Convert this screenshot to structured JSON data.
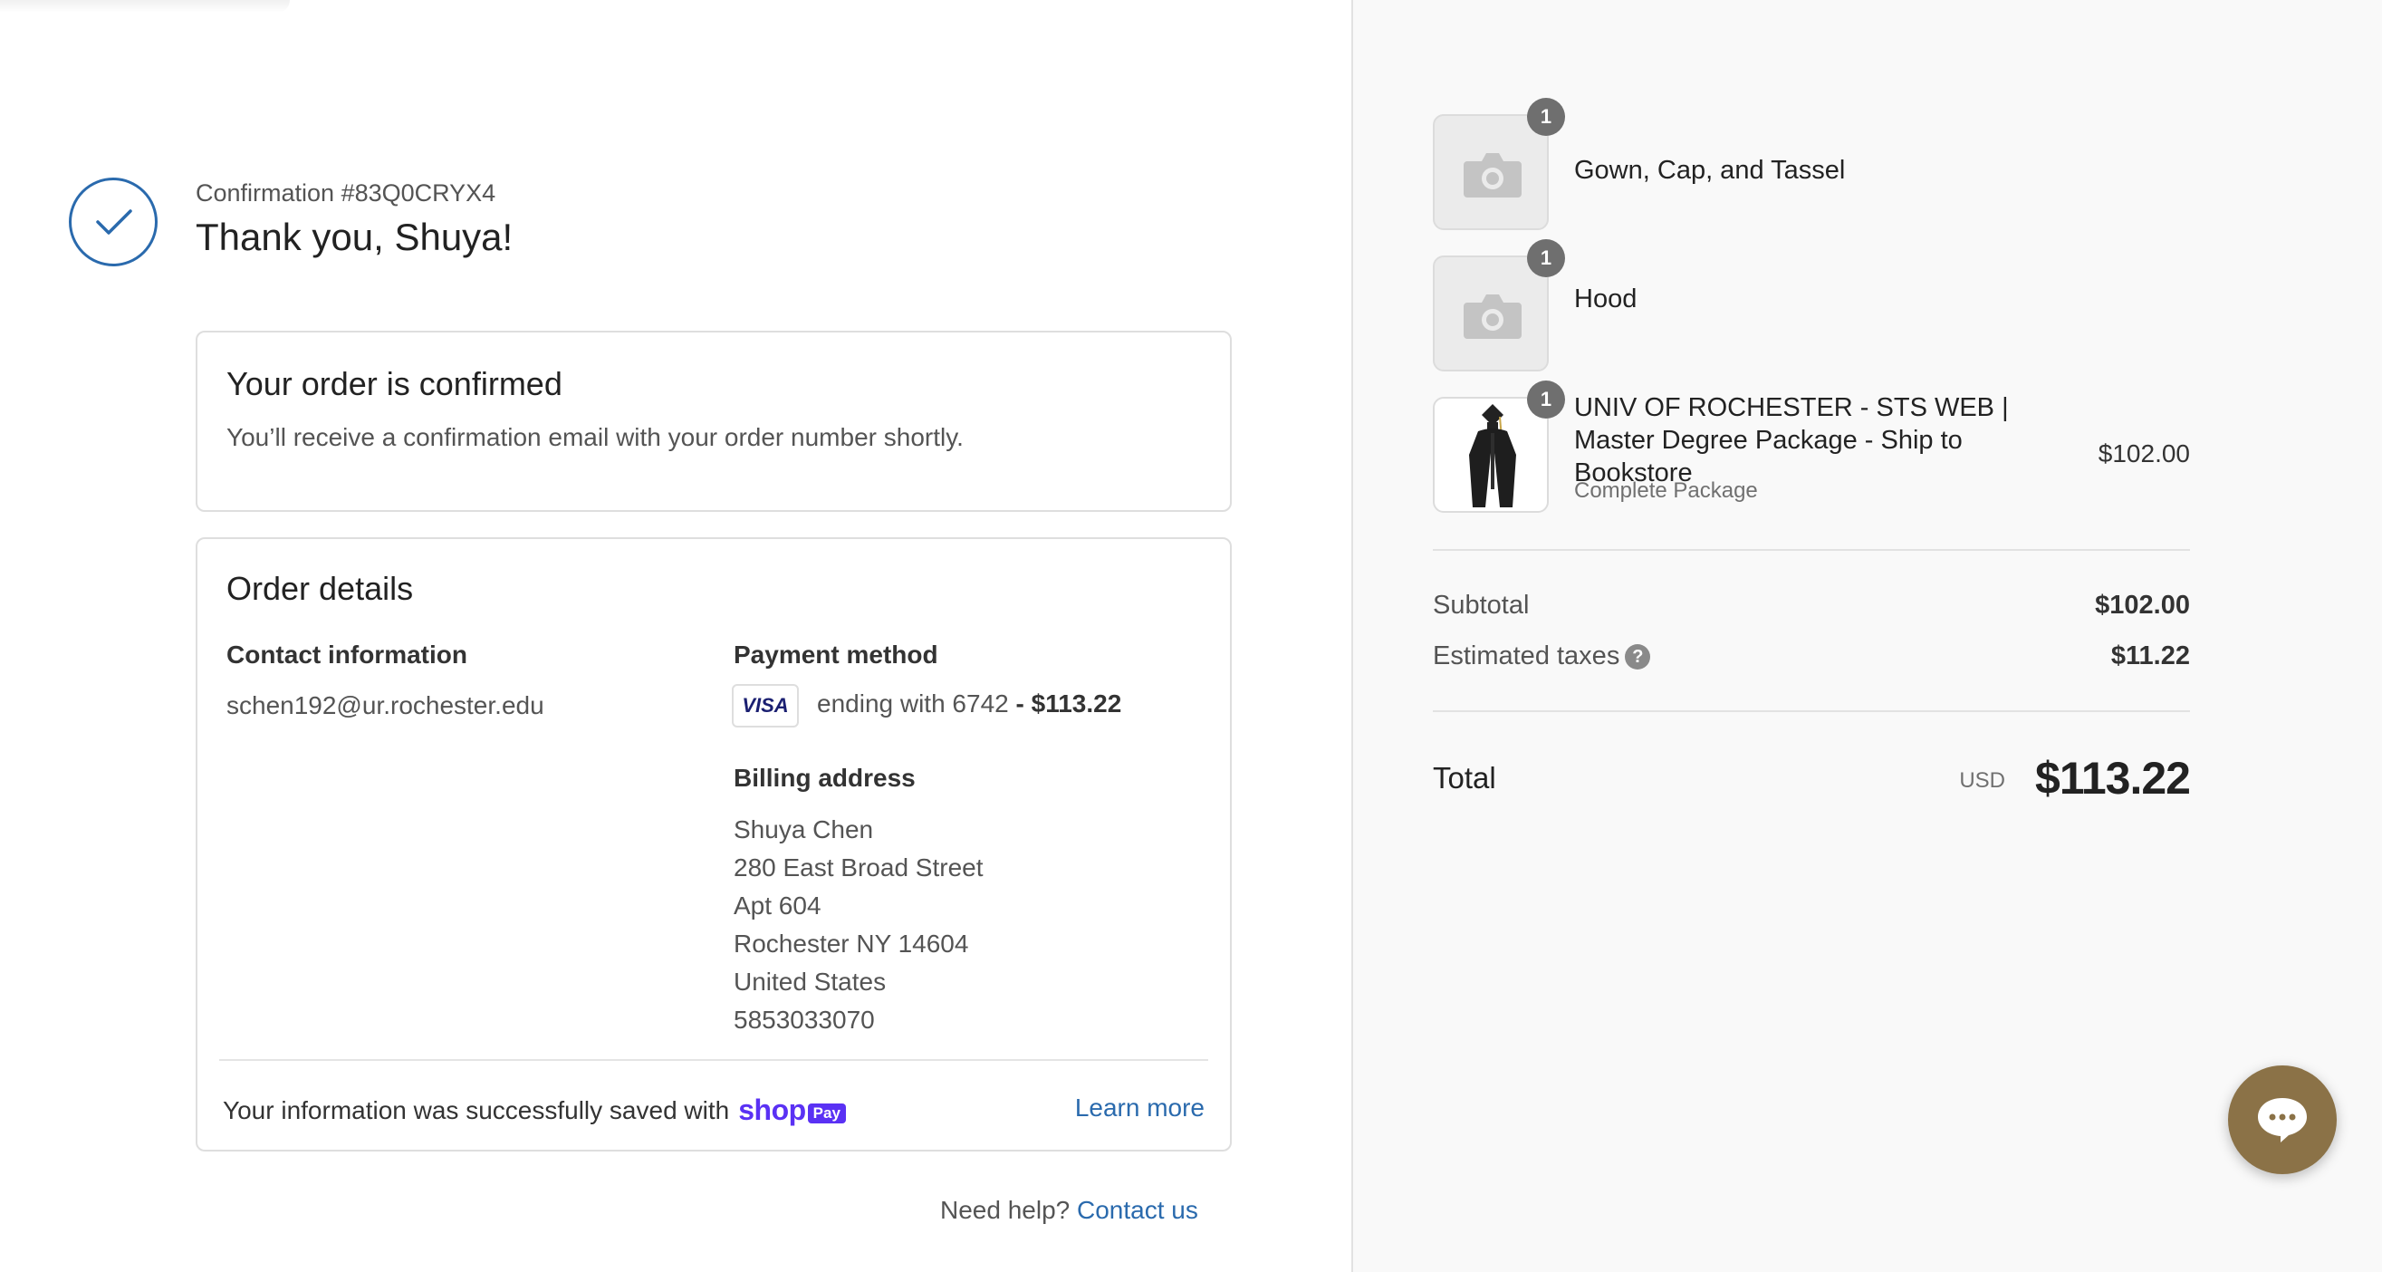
{
  "confirmation": {
    "label": "Confirmation #83Q0CRYX4",
    "thanks": "Thank you, Shuya!"
  },
  "order_confirmed": {
    "heading": "Your order is confirmed",
    "text": "You’ll receive a confirmation email with your order number shortly."
  },
  "order_details": {
    "heading": "Order details",
    "contact_label": "Contact information",
    "contact_email": "schen192@ur.rochester.edu",
    "payment_label": "Payment method",
    "card_brand": "VISA",
    "payment_text": "ending with 6742",
    "payment_amount": "- $113.22",
    "billing_label": "Billing address",
    "billing_lines": [
      "Shuya Chen",
      "280 East Broad Street",
      "Apt 604",
      "Rochester NY 14604",
      "United States",
      "5853033070"
    ],
    "saved_text": "Your information was successfully saved with",
    "shop_logo": "shop",
    "shop_pay_badge": "Pay",
    "learn_more": "Learn more"
  },
  "help": {
    "text": "Need help?",
    "link": "Contact us"
  },
  "cart": {
    "items": [
      {
        "title": "Gown, Cap, and Tassel",
        "qty": "1",
        "price": "",
        "variant": ""
      },
      {
        "title": "Hood",
        "qty": "1",
        "price": "",
        "variant": ""
      },
      {
        "title": "UNIV OF ROCHESTER - STS WEB | Master Degree Package - Ship to Bookstore",
        "qty": "1",
        "price": "$102.00",
        "variant": "Complete Package"
      }
    ],
    "subtotal_label": "Subtotal",
    "subtotal_value": "$102.00",
    "taxes_label": "Estimated taxes",
    "taxes_value": "$11.22",
    "total_label": "Total",
    "total_currency": "USD",
    "total_value": "$113.22"
  },
  "colors": {
    "accent": "#2a6aad",
    "shop_pay": "#5a31f4",
    "chat_button": "#8b7247"
  },
  "icons": {
    "confirm": "check-icon",
    "placeholder": "camera-icon",
    "help": "question-icon",
    "chat": "chat-bubble-icon"
  }
}
